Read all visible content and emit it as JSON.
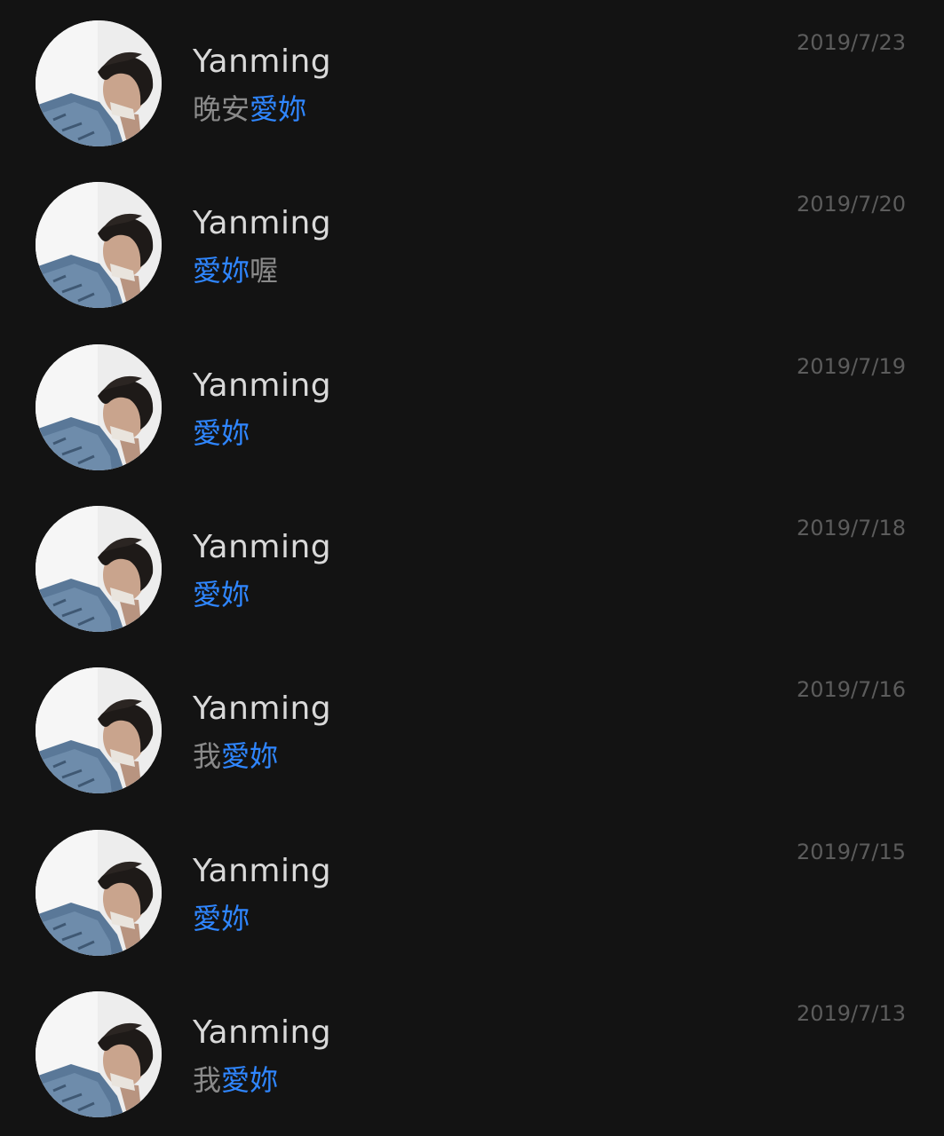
{
  "colors": {
    "background": "#131313",
    "name": "#d9d9d9",
    "preview_text": "#8a8a8a",
    "highlight": "#2f86ff",
    "date": "#5c5c5c"
  },
  "chats": [
    {
      "name": "Yanming",
      "date": "2019/7/23",
      "avatar_icon": "person-resting-head-photo",
      "preview": [
        {
          "text": "晚安",
          "highlight": false
        },
        {
          "text": "愛妳",
          "highlight": true
        }
      ]
    },
    {
      "name": "Yanming",
      "date": "2019/7/20",
      "avatar_icon": "person-resting-head-photo",
      "preview": [
        {
          "text": "愛妳",
          "highlight": true
        },
        {
          "text": "喔",
          "highlight": false
        }
      ]
    },
    {
      "name": "Yanming",
      "date": "2019/7/19",
      "avatar_icon": "person-resting-head-photo",
      "preview": [
        {
          "text": "愛妳",
          "highlight": true
        }
      ]
    },
    {
      "name": "Yanming",
      "date": "2019/7/18",
      "avatar_icon": "person-resting-head-photo",
      "preview": [
        {
          "text": "愛妳",
          "highlight": true
        }
      ]
    },
    {
      "name": "Yanming",
      "date": "2019/7/16",
      "avatar_icon": "person-resting-head-photo",
      "preview": [
        {
          "text": "我",
          "highlight": false
        },
        {
          "text": "愛妳",
          "highlight": true
        }
      ]
    },
    {
      "name": "Yanming",
      "date": "2019/7/15",
      "avatar_icon": "person-resting-head-photo",
      "preview": [
        {
          "text": "愛妳",
          "highlight": true
        }
      ]
    },
    {
      "name": "Yanming",
      "date": "2019/7/13",
      "avatar_icon": "person-resting-head-photo",
      "preview": [
        {
          "text": "我",
          "highlight": false
        },
        {
          "text": "愛妳",
          "highlight": true
        }
      ]
    }
  ]
}
